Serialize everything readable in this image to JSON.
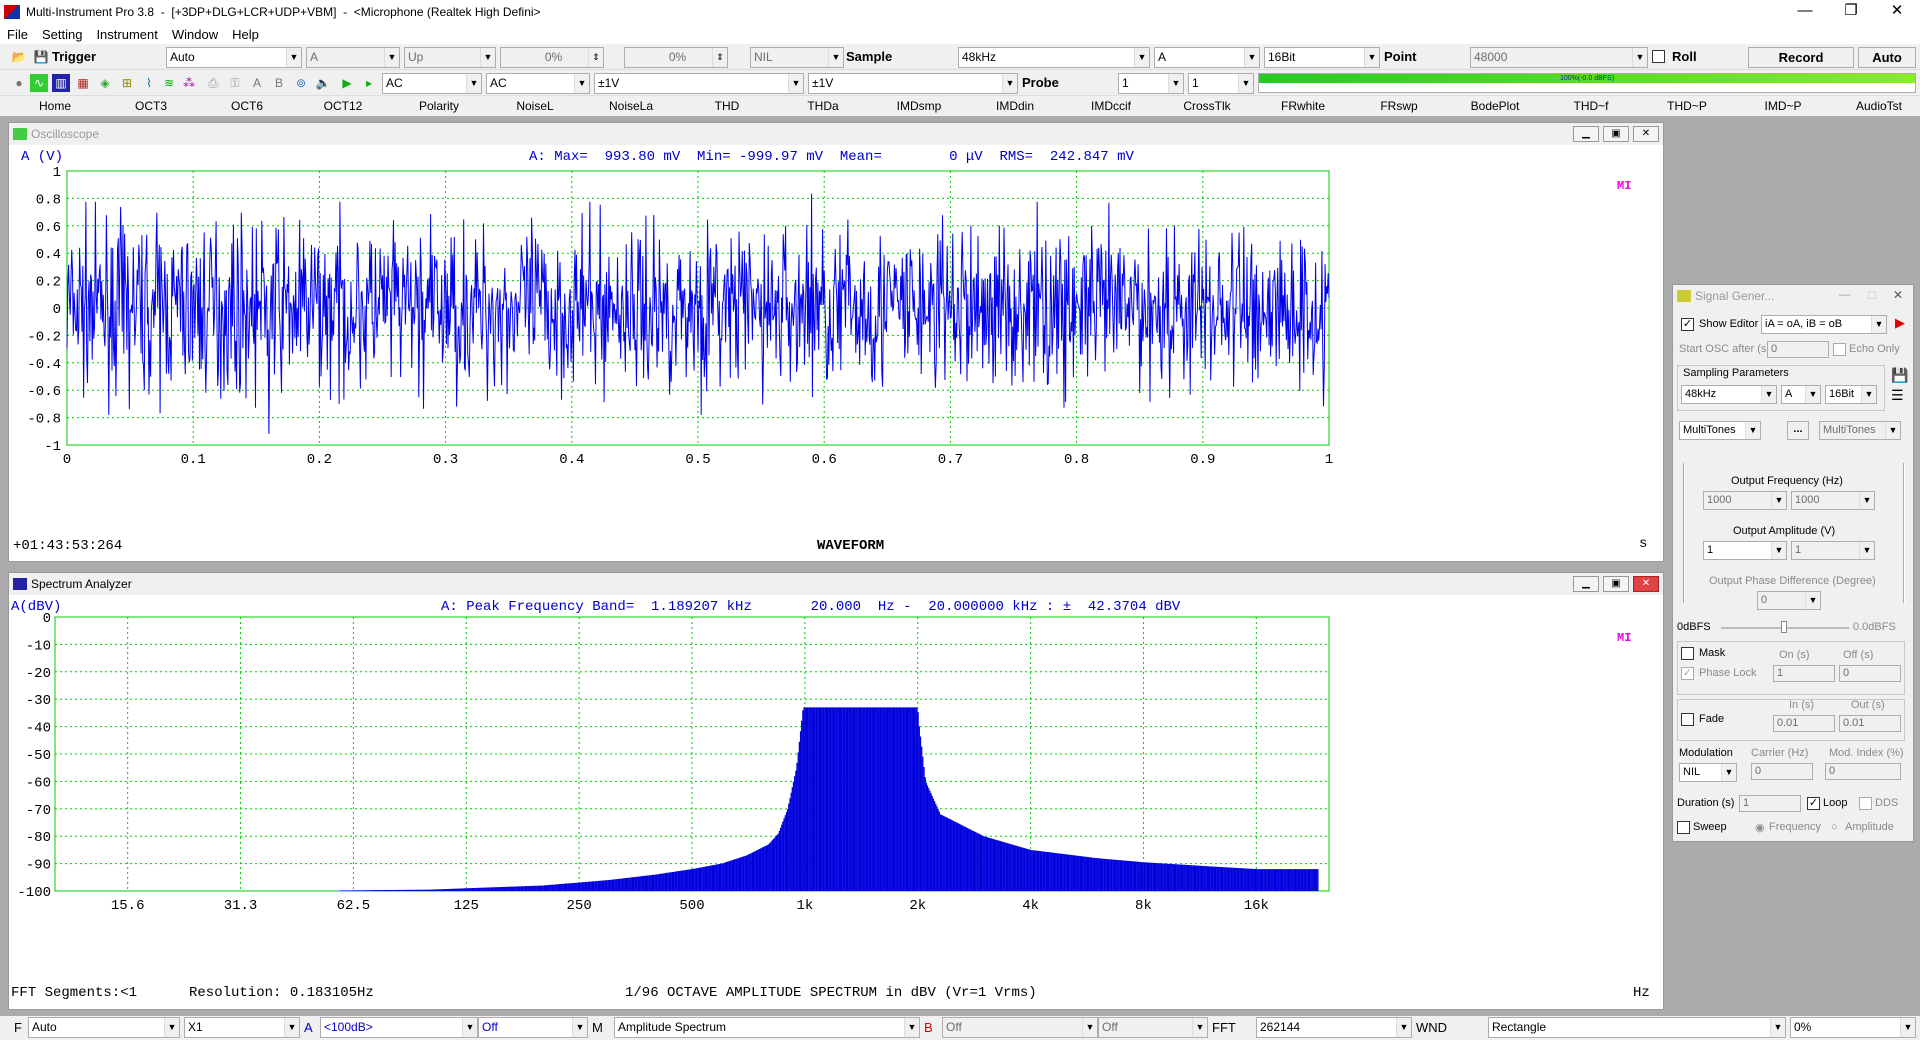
{
  "app": {
    "title": "Multi-Instrument Pro 3.8  -  [+3DP+DLG+LCR+UDP+VBM]  -  <Microphone (Realtek High Defini>",
    "window_controls": [
      "—",
      "❐",
      "✕"
    ]
  },
  "menu": [
    "File",
    "Setting",
    "Instrument",
    "Window",
    "Help"
  ],
  "toolbar1": {
    "trigger_label": "Trigger",
    "trigger_mode": "Auto",
    "channel": "A",
    "edge": "Up",
    "level1": "0%",
    "level2": "0%",
    "nil": "NIL",
    "sample_label": "Sample",
    "sample_rate": "48kHz",
    "sample_channel": "A",
    "bit_depth": "16Bit",
    "point_label": "Point",
    "point_value": "48000",
    "roll_label": "Roll",
    "record_label": "Record",
    "auto_label": "Auto"
  },
  "toolbar2": {
    "coupling_a": "AC",
    "coupling_b": "AC",
    "range_a": "±1V",
    "range_b": "±1V",
    "probe_label": "Probe",
    "probe_a": "1",
    "probe_b": "1",
    "level_meter_text": "100%(-0.0 dBFS)",
    "level_meter_percent": 100
  },
  "functions": [
    "Home",
    "OCT3",
    "OCT6",
    "OCT12",
    "Polarity",
    "NoiseL",
    "NoiseLa",
    "THD",
    "THDa",
    "IMDsmp",
    "IMDdin",
    "IMDccif",
    "CrossTlk",
    "FRwhite",
    "FRswp",
    "BodePlot",
    "THD~f",
    "THD~P",
    "IMD~P",
    "AudioTst"
  ],
  "oscilloscope": {
    "title": "Oscilloscope",
    "ylabel": "A (V)",
    "stats": "A: Max=  993.80 mV  Min= -999.97 mV  Mean=        0 μV  RMS=  242.847 mV",
    "time": "+01:43:53:264",
    "xunit": "s",
    "caption": "WAVEFORM",
    "watermark": "MI",
    "trace_color": "#0000ee",
    "grid_color": "#00cc00"
  },
  "spectrum": {
    "title": "Spectrum Analyzer",
    "ylabel": "A(dBV)",
    "header": "A: Peak Frequency Band=  1.189207 kHz       20.000  Hz -  20.000000 kHz : ±  42.3704 dBV",
    "fft_segments": "FFT Segments:<1",
    "resolution": "Resolution: 0.183105Hz",
    "caption": "1/96 OCTAVE AMPLITUDE SPECTRUM in dBV (Vr=1 Vrms)",
    "xunit": "Hz",
    "watermark": "MI"
  },
  "statusbar": {
    "f_label": "F",
    "f_mode": "Auto",
    "zoom": "X1",
    "a_label": "A",
    "a_range": "<100dB>",
    "a_off": "Off",
    "m_label": "M",
    "m_mode": "Amplitude Spectrum",
    "b_label": "B",
    "b_off1": "Off",
    "b_off2": "Off",
    "fft_label": "FFT",
    "fft_size": "262144",
    "wnd_label": "WND",
    "window_fn": "Rectangle",
    "overlap": "0%"
  },
  "signal_generator": {
    "title": "Signal Gener...",
    "show_editor": "Show Editor",
    "editor_expr": "iA = oA, iB = oB",
    "start_osc": "Start OSC after (s)",
    "start_osc_val": "0",
    "echo_only": "Echo Only",
    "sampling_params": "Sampling Parameters",
    "rate": "48kHz",
    "channel": "A",
    "bits": "16Bit",
    "waveform_a": "MultiTones",
    "more": "...",
    "waveform_b": "MultiTones",
    "out_freq": "Output Frequency (Hz)",
    "freq_a": "1000",
    "freq_b": "1000",
    "out_amp": "Output Amplitude (V)",
    "amp_a": "1",
    "amp_b": "1",
    "phase_diff": "Output Phase Difference (Degree)",
    "phase_val": "0",
    "dbfs_left": "0dBFS",
    "dbfs_right": "0.0dBFS",
    "mask": "Mask",
    "on_s": "On (s)",
    "off_s": "Off (s)",
    "phase_lock": "Phase Lock",
    "on_val": "1",
    "off_val": "0",
    "fade": "Fade",
    "in_s": "In (s)",
    "out_s": "Out (s)",
    "fade_in": "0.01",
    "fade_out": "0.01",
    "modulation": "Modulation",
    "carrier": "Carrier (Hz)",
    "mod_index": "Mod. Index (%)",
    "mod_type": "NIL",
    "carrier_val": "0",
    "mod_index_val": "0",
    "duration": "Duration (s)",
    "duration_val": "1",
    "loop": "Loop",
    "dds": "DDS",
    "sweep": "Sweep",
    "frequency": "Frequency",
    "amplitude": "Amplitude"
  },
  "chart_data": [
    {
      "type": "line",
      "title": "WAVEFORM",
      "xlabel": "s",
      "ylabel": "A (V)",
      "xlim": [
        0,
        1
      ],
      "ylim": [
        -1,
        1
      ],
      "x_ticks": [
        "0",
        "0.1",
        "0.2",
        "0.3",
        "0.4",
        "0.5",
        "0.6",
        "0.7",
        "0.8",
        "0.9",
        "1"
      ],
      "y_ticks": [
        "1",
        "0.8",
        "0.6",
        "0.4",
        "0.2",
        "0",
        "-0.2",
        "-0.4",
        "-0.6",
        "-0.8",
        "-1"
      ],
      "grid": true,
      "series": [
        {
          "name": "A",
          "envelope_max": 0.9938,
          "envelope_min": -0.99997,
          "rms": 0.242847,
          "mean": 0
        }
      ]
    },
    {
      "type": "bar",
      "title": "1/96 OCTAVE AMPLITUDE SPECTRUM in dBV (Vr=1 Vrms)",
      "xlabel": "Hz",
      "ylabel": "A(dBV)",
      "xscale": "log",
      "xlim": [
        10,
        25000
      ],
      "ylim": [
        -100,
        0
      ],
      "x_ticks": [
        "15.6",
        "31.3",
        "62.5",
        "125",
        "250",
        "500",
        "1k",
        "2k",
        "4k",
        "8k",
        "16k"
      ],
      "y_ticks": [
        "0",
        "-10",
        "-20",
        "-30",
        "-40",
        "-50",
        "-60",
        "-70",
        "-80",
        "-90",
        "-100"
      ],
      "grid": true,
      "profile": {
        "x": [
          40,
          100,
          125,
          200,
          300,
          400,
          500,
          600,
          700,
          800,
          850,
          900,
          950,
          990,
          2000,
          2020,
          2100,
          2300,
          3000,
          4000,
          6000,
          8000,
          12000,
          16000,
          25000
        ],
        "y": [
          -100,
          -99.5,
          -99,
          -98,
          -96,
          -94,
          -92,
          -90,
          -87,
          -83,
          -79,
          -70,
          -55,
          -33,
          -33,
          -40,
          -60,
          -72,
          -80,
          -85,
          -88,
          -89.5,
          -91,
          -92,
          -92
        ]
      }
    }
  ]
}
